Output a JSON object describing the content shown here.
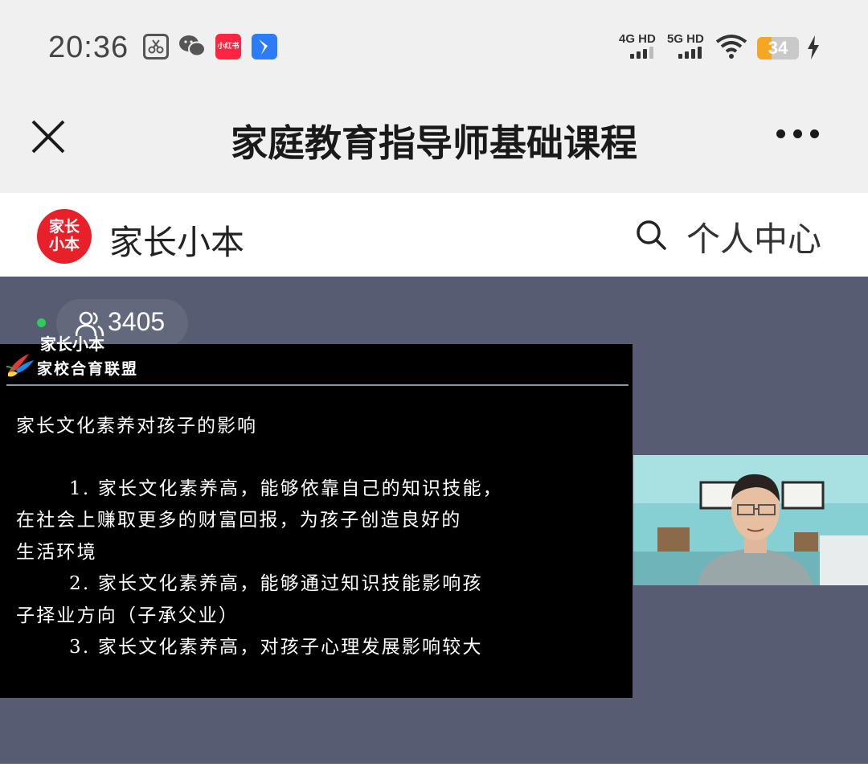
{
  "status_bar": {
    "time": "20:36",
    "app_icons": [
      "screenshot-scissor-icon",
      "wechat-icon",
      "xiaohongshu-icon",
      "feishu-icon"
    ],
    "xhs_label": "小红书",
    "network_1": "4G HD",
    "network_2": "5G HD",
    "battery_level": "34",
    "battery_percent": 34,
    "charging": true
  },
  "title_bar": {
    "title": "家庭教育指导师基础课程"
  },
  "nav": {
    "logo_text": "家长小本",
    "brand": "家长小本",
    "personal_center": "个人中心"
  },
  "live": {
    "viewer_count": "3405",
    "watermark": "家长小本"
  },
  "slide": {
    "brand": "家校合育联盟",
    "heading": "家长文化素养对孩子的影响",
    "lines": [
      "1. 家长文化素养高，能够依靠自己的知识技能，",
      "在社会上赚取更多的财富回报，为孩子创造良好的",
      "生活环境",
      "2. 家长文化素养高，能够通过知识技能影响孩",
      "子择业方向（子承父业）",
      "3. 家长文化素养高，对孩子心理发展影响较大"
    ]
  },
  "colors": {
    "live_bg": "#575c72",
    "logo_red": "#e8202a",
    "live_green": "#2ecc5c",
    "battery_orange": "#f5a623"
  }
}
